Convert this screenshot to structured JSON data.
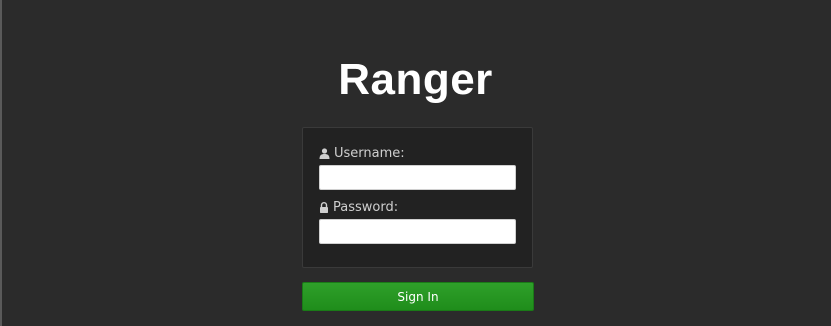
{
  "app": {
    "brand_title": "Ranger"
  },
  "login_form": {
    "username": {
      "label": "Username:",
      "value": "",
      "placeholder": "",
      "icon": "user-icon"
    },
    "password": {
      "label": "Password:",
      "value": "",
      "placeholder": "",
      "icon": "lock-icon"
    },
    "submit_label": "Sign In"
  },
  "colors": {
    "background": "#2b2b2b",
    "panel": "#222222",
    "primary_button": "#22961e",
    "brand_text": "#ffffff"
  }
}
